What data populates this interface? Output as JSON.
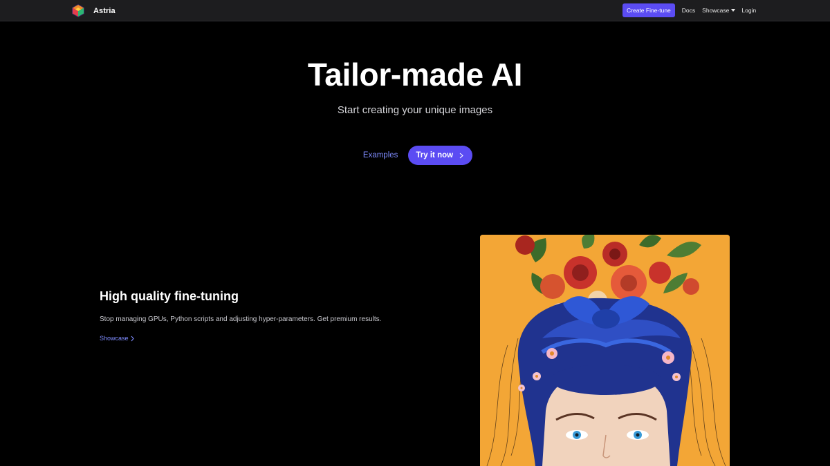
{
  "navbar": {
    "brand_name": "Astria",
    "logo_icon": "astria-hexagon-logo-icon",
    "create_button": "Create Fine-tune",
    "docs": "Docs",
    "showcase": "Showcase",
    "login": "Login",
    "showcase_icon": "caret-down-icon"
  },
  "hero": {
    "title": "Tailor-made AI",
    "subtitle": "Start creating your unique images",
    "examples_link": "Examples",
    "try_button": "Try it now",
    "try_icon": "chevron-right-icon"
  },
  "feature": {
    "title": "High quality fine-tuning",
    "description": "Stop managing GPUs, Python scripts and adjusting hyper-parameters. Get premium results.",
    "link": "Showcase",
    "link_icon": "chevron-right-icon"
  },
  "showcase_image": {
    "icon": "ai-portrait-artwork",
    "subject": "woman with flowers and blue headscarf"
  },
  "colors": {
    "accent": "#5b4cf3",
    "link": "#7f8cff",
    "navbar_bg": "#1d1d1f",
    "page_bg": "#000000",
    "art_bg": "#f3a636"
  }
}
